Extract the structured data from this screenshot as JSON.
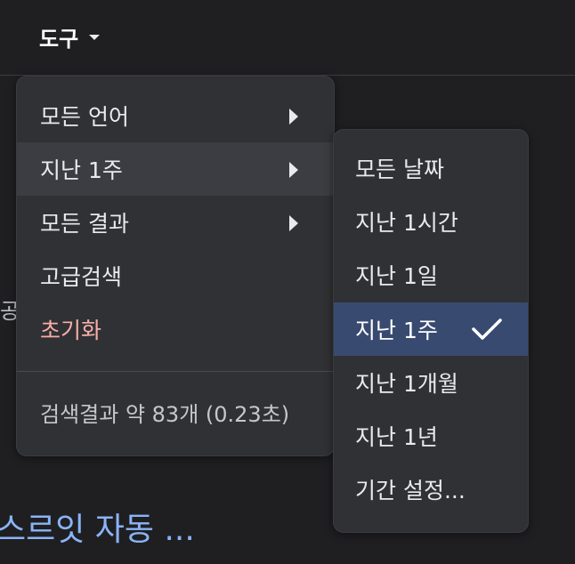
{
  "toolbar": {
    "tools_label": "도구"
  },
  "background": {
    "partial_text": "공",
    "partial_link": "스르잇 자동 ..."
  },
  "main_menu": {
    "items": [
      {
        "label": "모든 언어",
        "has_submenu": true
      },
      {
        "label": "지난 1주",
        "has_submenu": true,
        "state": "hover"
      },
      {
        "label": "모든 결과",
        "has_submenu": true
      },
      {
        "label": "고급검색",
        "has_submenu": false
      },
      {
        "label": "초기화",
        "has_submenu": false,
        "color": "#f6aea9"
      }
    ],
    "stats": "검색결과 약 83개 (0.23초)"
  },
  "submenu": {
    "items": [
      {
        "label": "모든 날짜"
      },
      {
        "label": "지난 1시간"
      },
      {
        "label": "지난 1일"
      },
      {
        "label": "지난 1주",
        "selected": true
      },
      {
        "label": "지난 1개월"
      },
      {
        "label": "지난 1년"
      },
      {
        "label": "기간 설정..."
      }
    ]
  },
  "colors": {
    "background": "#1f1f21",
    "menu": "#303134",
    "hover": "#3c3d42",
    "selected": "#394a71",
    "link": "#8ab4f8",
    "reset": "#f6aea9"
  }
}
